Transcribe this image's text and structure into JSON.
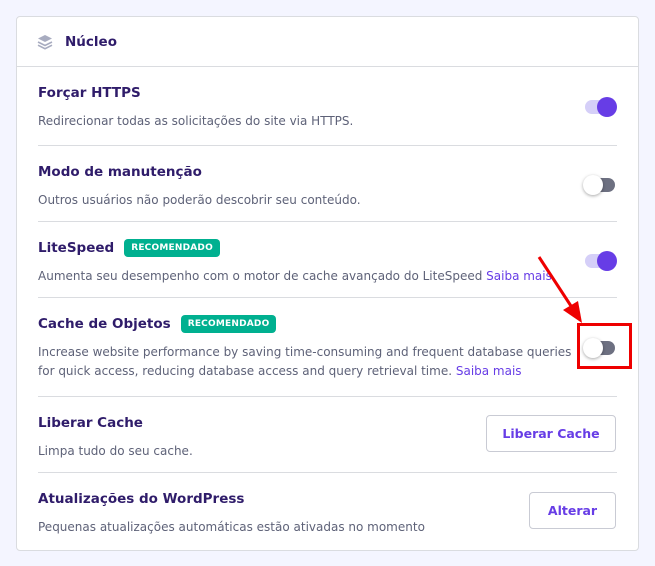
{
  "section": {
    "title": "Núcleo",
    "icon": "layers-icon"
  },
  "rows": [
    {
      "title": "Forçar HTTPS",
      "desc": "Redirecionar todas as solicitações do site via HTTPS.",
      "toggle": "on"
    },
    {
      "title": "Modo de manutenção",
      "desc": "Outros usuários não poderão descobrir seu conteúdo.",
      "toggle": "off"
    },
    {
      "title": "LiteSpeed",
      "badge": "RECOMENDADO",
      "desc": "Aumenta seu desempenho com o motor de cache avançado do LiteSpeed ",
      "link": "Saiba mais",
      "toggle": "on"
    },
    {
      "title": "Cache de Objetos",
      "badge": "RECOMENDADO",
      "desc": "Increase website performance by saving time-consuming and frequent database queries for quick access, reducing database access and query retrieval time. ",
      "link": "Saiba mais",
      "toggle": "off"
    },
    {
      "title": "Liberar Cache",
      "desc": "Limpa tudo do seu cache.",
      "button": "Liberar Cache"
    },
    {
      "title": "Atualizações do WordPress",
      "desc": "Pequenas atualizações automáticas estão ativadas no momento",
      "button": "Alterar"
    }
  ],
  "colors": {
    "accent": "#673de6",
    "badge": "#00b090",
    "annotation": "#e00000"
  }
}
